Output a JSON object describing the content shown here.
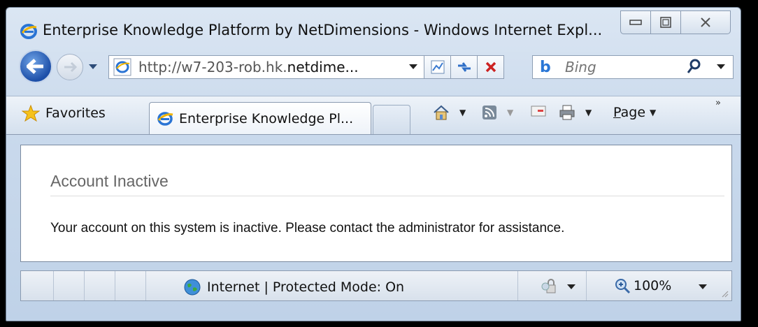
{
  "window": {
    "title": "Enterprise Knowledge Platform by NetDimensions - Windows Internet Expl..."
  },
  "nav": {
    "url_prefix": "http://w7-203-rob.hk.",
    "url_domain": "netdime...",
    "search_placeholder": "Bing",
    "search_provider_logo": "b"
  },
  "favorites_bar": {
    "favorites_label": "Favorites",
    "tab_label": "Enterprise Knowledge Pl...",
    "page_menu_label": "Page",
    "page_menu_access_key": "P",
    "page_menu_rest": "age"
  },
  "content": {
    "heading": "Account Inactive",
    "message": "Your account on this system is inactive. Please contact the administrator for assistance."
  },
  "status_bar": {
    "zone_text": "Internet | Protected Mode: On",
    "zoom": "100%"
  },
  "colors": {
    "ie_blue": "#1d4fa8",
    "stop_red": "#cc2222",
    "heading_gray": "#666666"
  },
  "icons": [
    "ie-logo-icon",
    "minimize-icon",
    "maximize-icon",
    "close-icon",
    "back-arrow-icon",
    "forward-arrow-icon",
    "dropdown-icon",
    "compat-view-icon",
    "refresh-icon",
    "stop-icon",
    "bing-logo-icon",
    "search-icon",
    "favorites-star-icon",
    "home-icon",
    "feeds-icon",
    "mail-icon",
    "print-icon",
    "globe-icon",
    "security-icon",
    "zoom-icon"
  ]
}
